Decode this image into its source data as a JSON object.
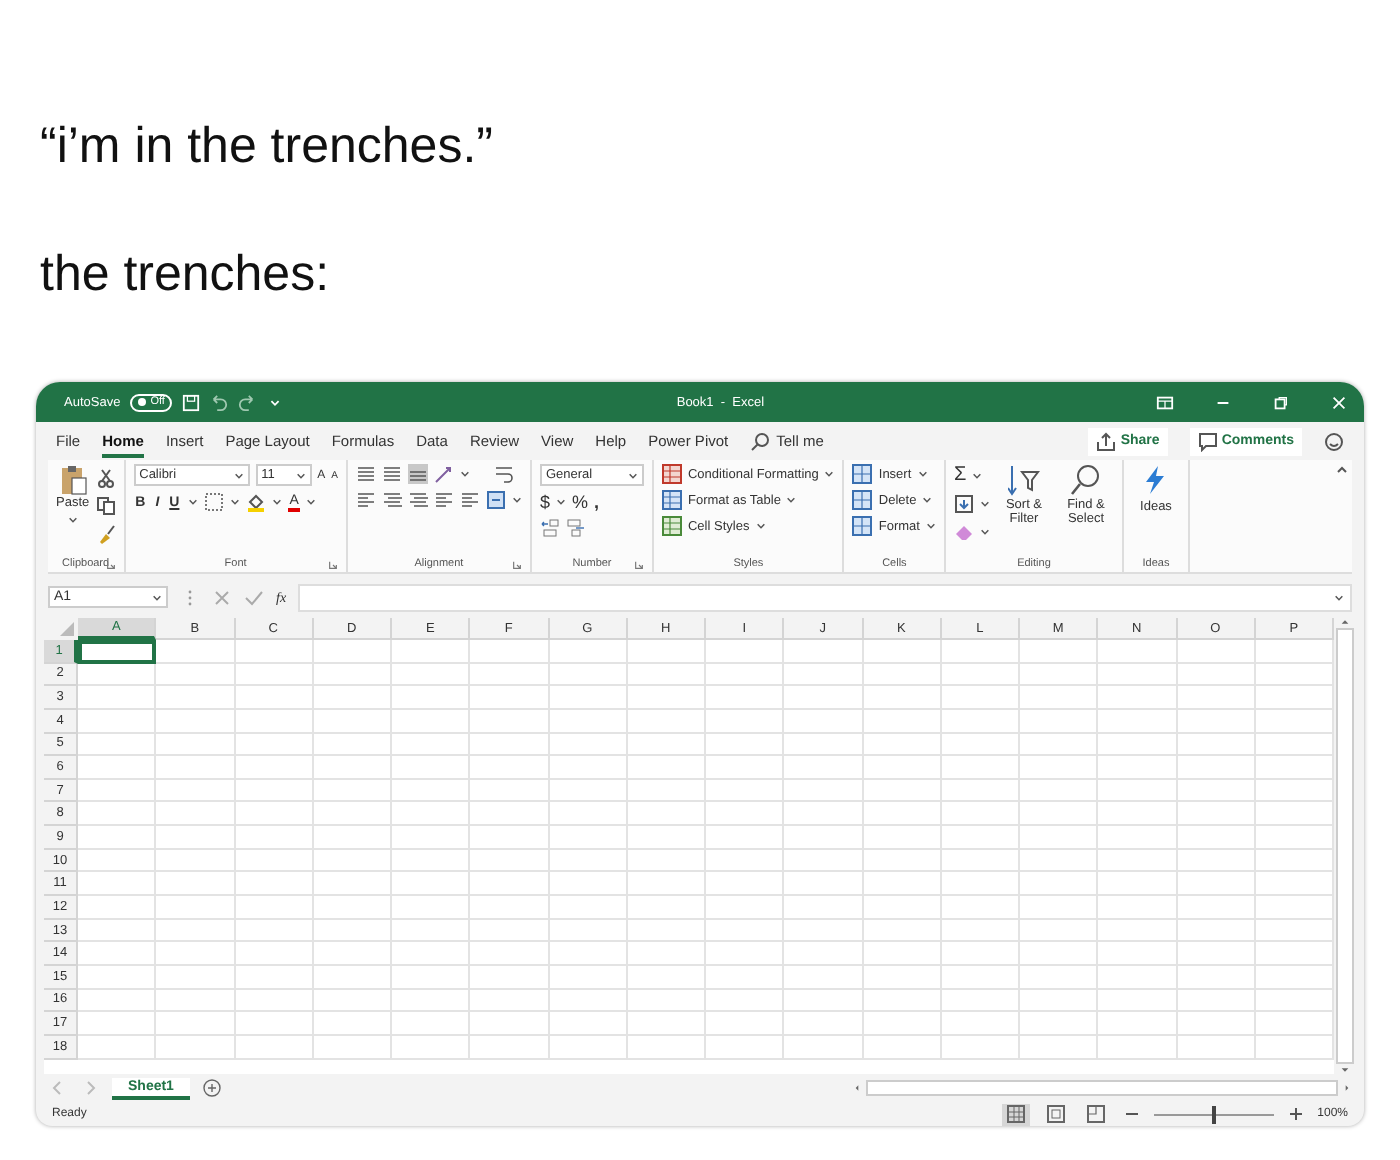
{
  "caption": {
    "quote": "“i’m in the trenches.”",
    "answer": "the trenches:"
  },
  "window": {
    "title": "Book1  -  Excel",
    "autosave": {
      "label": "AutoSave",
      "toggle": "Off",
      "on": false
    }
  },
  "menu_tabs": [
    {
      "label": "File",
      "selected": false
    },
    {
      "label": "Home",
      "selected": true
    },
    {
      "label": "Insert",
      "selected": false
    },
    {
      "label": "Page Layout",
      "selected": false
    },
    {
      "label": "Formulas",
      "selected": false
    },
    {
      "label": "Data",
      "selected": false
    },
    {
      "label": "Review",
      "selected": false
    },
    {
      "label": "View",
      "selected": false
    },
    {
      "label": "Help",
      "selected": false
    },
    {
      "label": "Power Pivot",
      "selected": false
    }
  ],
  "tell_me": "Tell me",
  "share": "Share",
  "comments": "Comments",
  "ribbon": {
    "groups": [
      {
        "kind": "clipboard",
        "label": "Clipboard",
        "paste": "Paste"
      },
      {
        "kind": "font",
        "label": "Font",
        "font_name": "Calibri",
        "font_size": "11",
        "grow": "A",
        "shrink": "A",
        "bold": "B",
        "italic": "I",
        "underline": "U",
        "font_color": "A"
      },
      {
        "kind": "alignment",
        "label": "Alignment"
      },
      {
        "kind": "number",
        "label": "Number",
        "format": "General",
        "currency": "$",
        "percent": "%",
        "comma": ","
      },
      {
        "kind": "styles",
        "label": "Styles",
        "items": [
          "Conditional Formatting",
          "Format as Table",
          "Cell Styles"
        ]
      },
      {
        "kind": "cells",
        "label": "Cells",
        "items": [
          "Insert",
          "Delete",
          "Format"
        ]
      },
      {
        "kind": "editing",
        "label": "Editing",
        "sum": "Σ",
        "items": [
          "Sort & Filter",
          "Find & Select"
        ]
      },
      {
        "kind": "ideas",
        "label": "Ideas",
        "button": "Ideas"
      }
    ]
  },
  "formula_bar": {
    "name_box": "A1",
    "function_label": "fx"
  },
  "sheet": {
    "columns": [
      {
        "label": "A",
        "selected": true
      },
      {
        "label": "B",
        "selected": false
      },
      {
        "label": "C",
        "selected": false
      },
      {
        "label": "D",
        "selected": false
      },
      {
        "label": "E",
        "selected": false
      },
      {
        "label": "F",
        "selected": false
      },
      {
        "label": "G",
        "selected": false
      },
      {
        "label": "H",
        "selected": false
      },
      {
        "label": "I",
        "selected": false
      },
      {
        "label": "J",
        "selected": false
      },
      {
        "label": "K",
        "selected": false
      },
      {
        "label": "L",
        "selected": false
      },
      {
        "label": "M",
        "selected": false
      },
      {
        "label": "N",
        "selected": false
      },
      {
        "label": "O",
        "selected": false
      },
      {
        "label": "P",
        "selected": false
      }
    ],
    "rows": [
      {
        "label": "1",
        "selected": true
      },
      {
        "label": "2",
        "selected": false
      },
      {
        "label": "3",
        "selected": false
      },
      {
        "label": "4",
        "selected": false
      },
      {
        "label": "5",
        "selected": false
      },
      {
        "label": "6",
        "selected": false
      },
      {
        "label": "7",
        "selected": false
      },
      {
        "label": "8",
        "selected": false
      },
      {
        "label": "9",
        "selected": false
      },
      {
        "label": "10",
        "selected": false
      },
      {
        "label": "11",
        "selected": false
      },
      {
        "label": "12",
        "selected": false
      },
      {
        "label": "13",
        "selected": false
      },
      {
        "label": "14",
        "selected": false
      },
      {
        "label": "15",
        "selected": false
      },
      {
        "label": "16",
        "selected": false
      },
      {
        "label": "17",
        "selected": false
      },
      {
        "label": "18",
        "selected": false
      }
    ]
  },
  "sheet_tabs": [
    {
      "label": "Sheet1",
      "selected": true
    }
  ],
  "status_bar": {
    "status": "Ready",
    "views": [
      {
        "kind": "normal",
        "selected": true
      },
      {
        "kind": "page_layout",
        "selected": false
      },
      {
        "kind": "page_break",
        "selected": false
      }
    ],
    "zoom": {
      "level": 0.5,
      "reading": "100%"
    }
  }
}
